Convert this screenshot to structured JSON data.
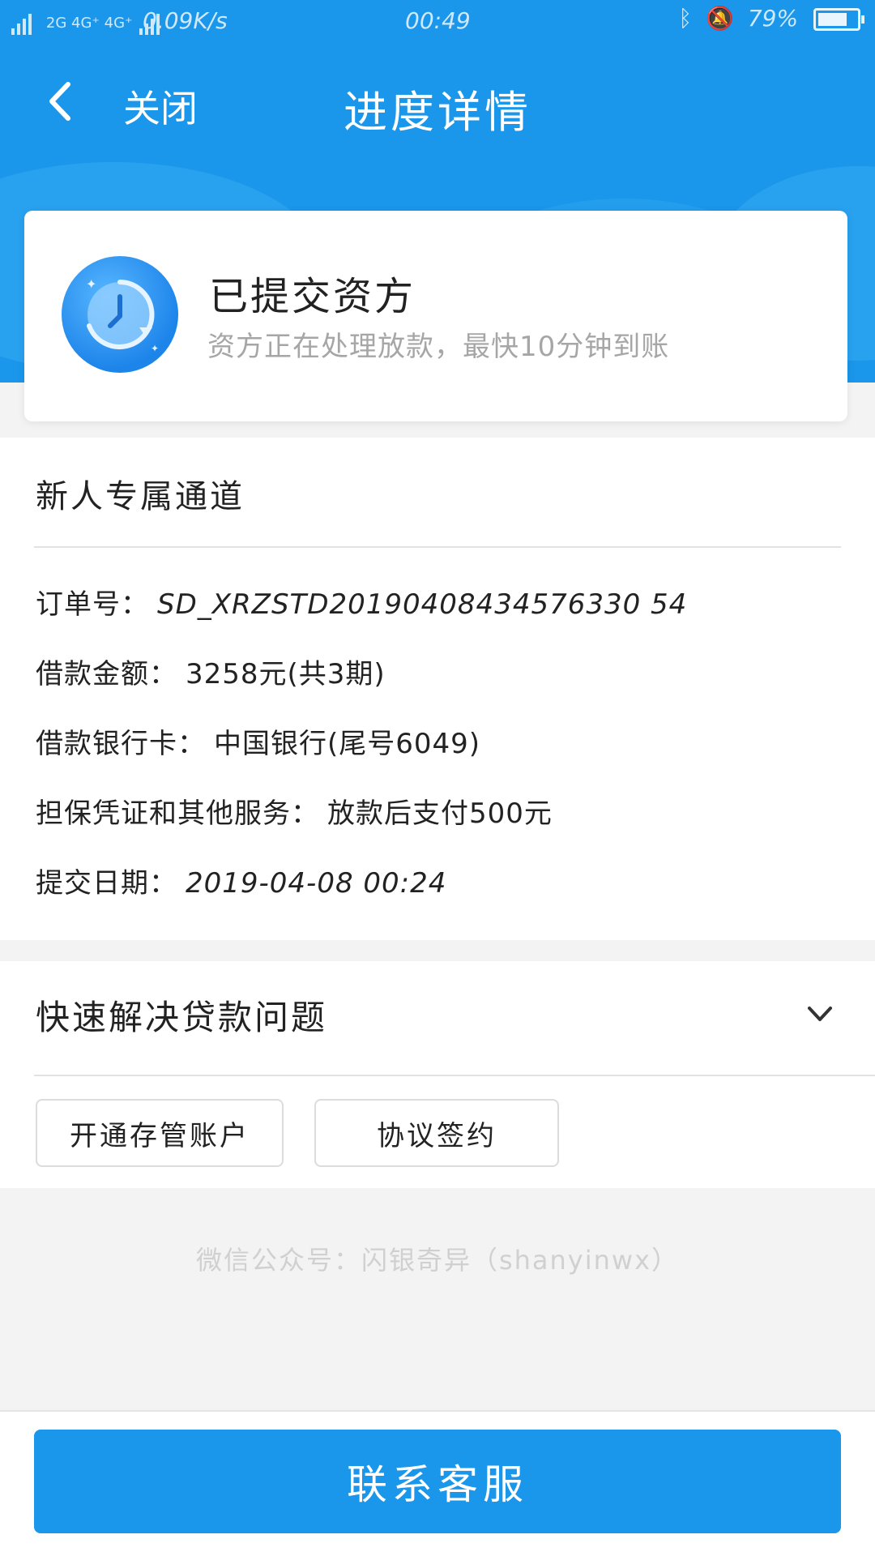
{
  "status_bar": {
    "signal_text": "2G 4G⁺ 4G⁺",
    "net_speed": "0.09K/s",
    "time": "00:49",
    "battery": "79%",
    "battery_level": 0.79
  },
  "nav": {
    "close_label": "关闭",
    "title": "进度详情"
  },
  "status_card": {
    "title": "已提交资方",
    "subtitle": "资方正在处理放款，最快10分钟到账"
  },
  "order": {
    "section_title": "新人专属通道",
    "fields": [
      {
        "label": "订单号：",
        "value": "SD_XRZSTD20190408434576330 54"
      },
      {
        "label": "借款金额：",
        "value": "3258元(共3期)"
      },
      {
        "label": "借款银行卡：",
        "value": "中国银行(尾号6049)"
      },
      {
        "label": "担保凭证和其他服务：",
        "value": "放款后支付500元"
      },
      {
        "label": "提交日期：",
        "value": "2019-04-08 00:24"
      }
    ]
  },
  "faq": {
    "title": "快速解决贷款问题",
    "buttons": [
      "开通存管账户",
      "协议签约"
    ]
  },
  "watermark": "微信公众号：闪银奇异（shanyinwx）",
  "footer": {
    "cta_label": "联系客服"
  },
  "colors": {
    "brand_blue": "#1a96ea",
    "text": "#222222",
    "muted": "#a6a6a6"
  }
}
